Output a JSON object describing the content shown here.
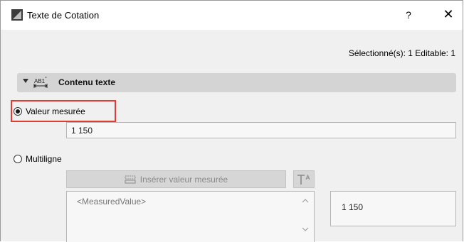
{
  "window": {
    "title": "Texte de Cotation",
    "help_label": "?",
    "close_label": "✕"
  },
  "selection_info": "Sélectionné(s): 1 Editable: 1",
  "section": {
    "title": "Contenu texte",
    "icon_text": "AB1",
    "icon_superscript": "°"
  },
  "measured_value": {
    "radio_label": "Valeur mesurée",
    "selected": true,
    "field_value": "1 150"
  },
  "multiline": {
    "radio_label": "Multiligne",
    "selected": false,
    "insert_button_label": "Insérer valeur mesurée",
    "text_content": "<MeasuredValue>",
    "preview_value": "1 150"
  },
  "colors": {
    "highlight": "#e53935",
    "section_header_bg": "#d4d4d4",
    "window_bg": "#f0f0f0"
  }
}
